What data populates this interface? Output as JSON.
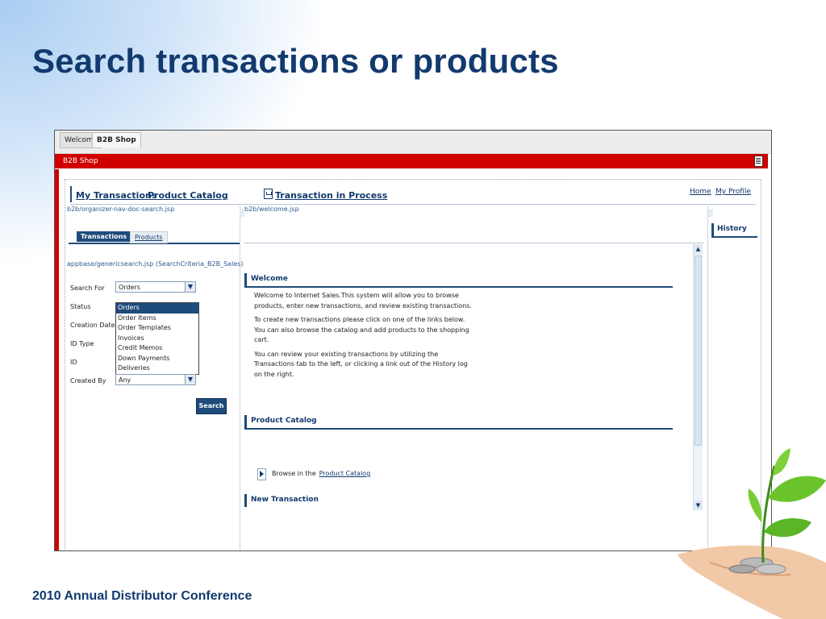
{
  "slide": {
    "title": "Search transactions or products",
    "footer": "2010 Annual Distributor Conference"
  },
  "app": {
    "top_tabs": [
      "Welcome",
      "B2B Shop"
    ],
    "header_bar": "B2B Shop",
    "nav": {
      "my_transactions": "My Transactions",
      "product_catalog": "Product Catalog",
      "transaction_in_process": "Transaction in Process",
      "home": "Home",
      "my_profile": "My Profile"
    },
    "left": {
      "path_top": "b2b/organizer-nav-doc-search.jsp",
      "tabs": {
        "transactions": "Transactions",
        "products": "Products"
      },
      "path_form": "appbase/genericsearch.jsp (SearchCriteria_B2B_Sales)",
      "labels": {
        "search_for": "Search For",
        "status": "Status",
        "creation_date": "Creation Date",
        "id_type": "ID Type",
        "id": "ID",
        "created_by": "Created By"
      },
      "search_for_value": "Orders",
      "dropdown_options": [
        "Orders",
        "Order Items",
        "Order Templates",
        "Invoices",
        "Credit Memos",
        "Down Payments",
        "Deliveries"
      ],
      "created_by_value": "Any",
      "search_button": "Search"
    },
    "main": {
      "path": "b2b/welcome.jsp",
      "welcome_title": "Welcome",
      "welcome_p1": "Welcome to Internet Sales.This system will allow you to browse products, enter new transactions, and review existing transactions.",
      "welcome_p2": "To create new transactions please click on one of the links below. You can also browse the catalog and add products to the shopping cart.",
      "welcome_p3": "You can review your existing transactions by utilizing the Transactions tab to the left, or clicking a link out of the History log on the right.",
      "catalog_title": "Product Catalog",
      "browse_prefix": "Browse in the",
      "browse_link": "Product Catalog",
      "new_transaction_title": "New Transaction"
    },
    "right": {
      "history_title": "History"
    }
  }
}
